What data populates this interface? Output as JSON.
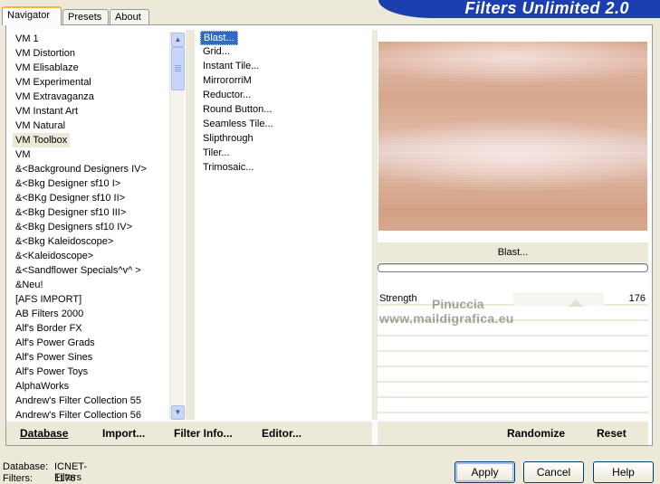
{
  "tabs": [
    "Navigator",
    "Presets",
    "About"
  ],
  "app_title": "Filters Unlimited 2.0",
  "categories": [
    "VM 1",
    "VM Distortion",
    "VM Elisablaze",
    "VM Experimental",
    "VM Extravaganza",
    "VM Instant Art",
    "VM Natural",
    "VM Toolbox",
    "VM",
    "&<Background Designers IV>",
    "&<Bkg Designer sf10 I>",
    "&<BKg Designer sf10 II>",
    "&<Bkg Designer sf10 III>",
    "&<Bkg Designers sf10 IV>",
    "&<Bkg Kaleidoscope>",
    "&<Kaleidoscope>",
    "&<Sandflower Specials^v^ >",
    "&Neu!",
    "[AFS IMPORT]",
    "AB Filters 2000",
    "Alf's Border FX",
    "Alf's Power Grads",
    "Alf's Power Sines",
    "Alf's Power Toys",
    "AlphaWorks",
    "Andrew's Filter Collection 55",
    "Andrew's Filter Collection 56"
  ],
  "selected_category": "VM Toolbox",
  "filters": [
    "Blast...",
    "Grid...",
    "Instant Tile...",
    "MirrororriM",
    "Reductor...",
    "Round Button...",
    "Seamless Tile...",
    "Slipthrough",
    "Tiler...",
    "Trimosaic..."
  ],
  "selected_filter": "Blast...",
  "preview_filter_name": "Blast...",
  "progress": 0,
  "params": [
    {
      "label": "Strength",
      "value": "176",
      "fraction": 0.69
    }
  ],
  "watermark": {
    "line1": "Pinuccia",
    "line2": "www.maildigrafica.eu"
  },
  "left_bar": {
    "database": "Database",
    "import": "Import...",
    "filter_info": "Filter Info...",
    "editor": "Editor..."
  },
  "right_bar": {
    "randomize": "Randomize",
    "reset": "Reset"
  },
  "status": {
    "database_label": "Database:",
    "database_value": "ICNET-Filters",
    "filters_label": "Filters:",
    "filters_value": "1176"
  },
  "buttons": {
    "apply": "Apply",
    "cancel": "Cancel",
    "help": "Help"
  },
  "colors": {
    "selection": "#316ac5",
    "banner": "#1c3fb0",
    "panel": "#ece9d8"
  }
}
